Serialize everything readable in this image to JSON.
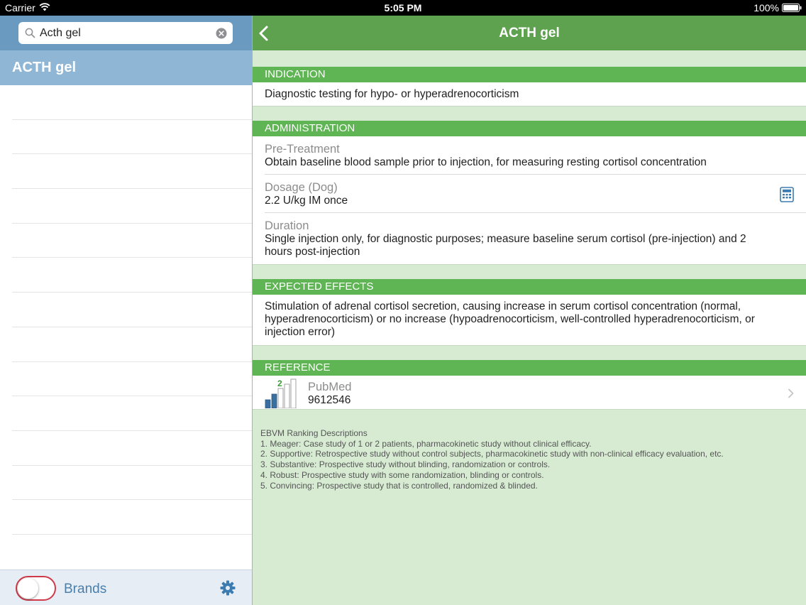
{
  "status_bar": {
    "carrier": "Carrier",
    "time": "5:05 PM",
    "battery": "100%"
  },
  "search": {
    "value": "Acth gel",
    "placeholder": ""
  },
  "results": [
    {
      "label": "ACTH gel"
    }
  ],
  "bottom_bar": {
    "toggle_label": "Brands"
  },
  "detail": {
    "title": "ACTH gel",
    "sections": {
      "indication": {
        "header": "INDICATION",
        "text": "Diagnostic testing for hypo- or hyperadrenocorticism"
      },
      "administration": {
        "header": "ADMINISTRATION",
        "pretreatment_title": "Pre-Treatment",
        "pretreatment_text": "Obtain baseline blood sample prior to injection, for measuring resting cortisol concentration",
        "dosage_title": "Dosage (Dog)",
        "dosage_text": "2.2 U/kg IM once",
        "duration_title": "Duration",
        "duration_text": "Single injection only, for diagnostic purposes; measure baseline serum cortisol (pre-injection) and 2 hours post-injection"
      },
      "expected_effects": {
        "header": "EXPECTED EFFECTS",
        "text": "Stimulation of adrenal cortisol secretion, causing increase in serum cortisol concentration (normal, hyperadrenocorticism) or no increase (hypoadrenocorticism, well-controlled hyperadrenocorticism, or injection error)"
      },
      "reference": {
        "header": "REFERENCE",
        "source": "PubMed",
        "id": "9612546",
        "rank": "2"
      }
    },
    "ranking": {
      "title": "EBVM Ranking Descriptions",
      "items": [
        "1. Meager: Case study of 1 or 2 patients, pharmacokinetic study without clinical efficacy.",
        "2. Supportive: Retrospective study without control subjects, pharmacokinetic study with non-clinical efficacy evaluation, etc.",
        "3. Substantive: Prospective study without blinding, randomization or controls.",
        "4. Robust: Prospective study with some randomization, blinding or controls.",
        "5. Convincing: Prospective study that is controlled, randomized & blinded."
      ]
    }
  },
  "icons": {
    "wifi": "wifi-icon",
    "battery": "battery-icon",
    "search": "search-icon",
    "clear": "clear-icon",
    "gear": "gear-icon",
    "back": "back-icon",
    "calculator": "calculator-icon",
    "chevron": "chevron-right-icon",
    "ranking": "ranking-bars-icon"
  },
  "colors": {
    "nav_green": "#5ea250",
    "section_green": "#5fb454",
    "panel_bg": "#d6ebd2",
    "sidebar_blue": "#6a9ac0",
    "selected_blue": "#90b6d6",
    "accent_blue": "#4a7eab",
    "toggle_red": "#d0394a"
  }
}
